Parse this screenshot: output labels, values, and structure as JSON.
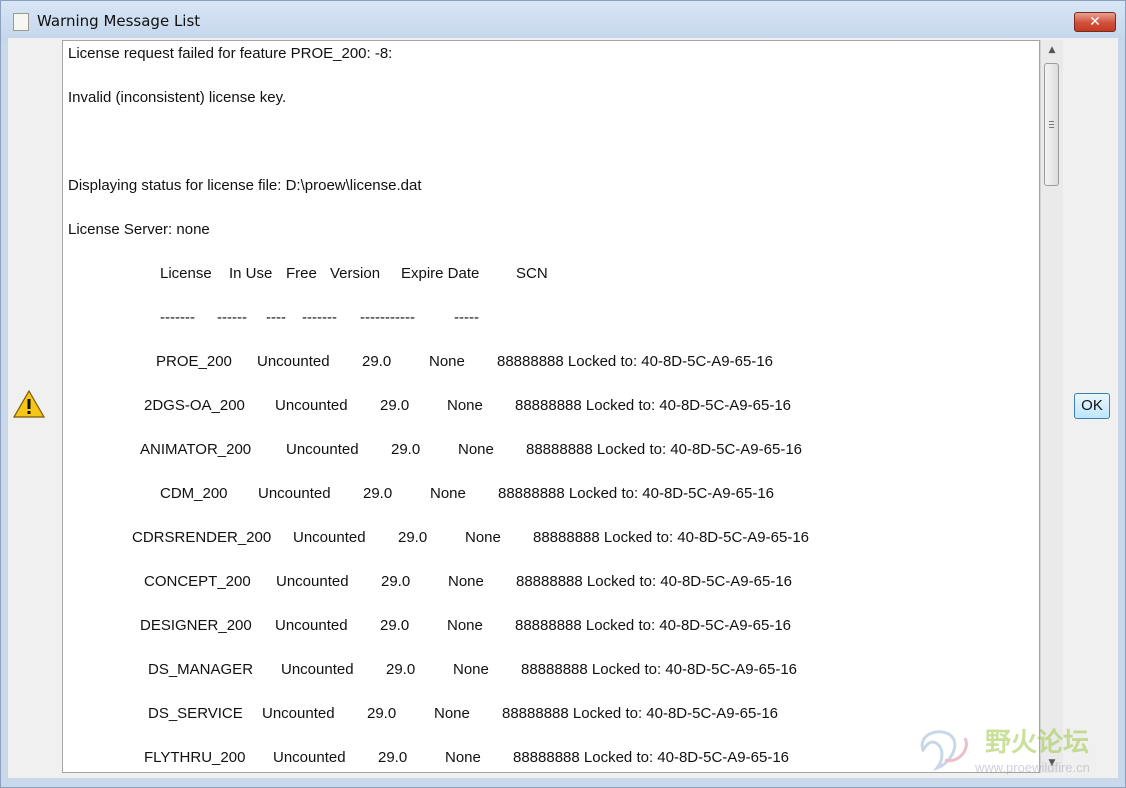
{
  "window": {
    "title": "Warning Message List",
    "close_label": "✕",
    "ok_label": "OK"
  },
  "message": {
    "lines": [
      "License request failed for feature PROE_200: -8:",
      "Invalid (inconsistent) license key.",
      "",
      "Displaying status for license file: D:\\proew\\license.dat",
      "License Server: none"
    ],
    "table_header": [
      "License",
      "In Use",
      "Free",
      "Version",
      "Expire Date",
      "SCN"
    ],
    "table_separator": [
      "-------",
      "------",
      "----",
      "-------",
      "-----------",
      "-----"
    ],
    "rows": [
      {
        "license": "PROE_200",
        "in_use": "Uncounted",
        "version": "29.0",
        "expire": "None",
        "scn": "88888888 Locked to: 40-8D-5C-A9-65-16"
      },
      {
        "license": "2DGS-OA_200",
        "in_use": "Uncounted",
        "version": "29.0",
        "expire": "None",
        "scn": "88888888 Locked to: 40-8D-5C-A9-65-16"
      },
      {
        "license": "ANIMATOR_200",
        "in_use": "Uncounted",
        "version": "29.0",
        "expire": "None",
        "scn": "88888888 Locked to: 40-8D-5C-A9-65-16"
      },
      {
        "license": "CDM_200",
        "in_use": "Uncounted",
        "version": "29.0",
        "expire": "None",
        "scn": "88888888 Locked to: 40-8D-5C-A9-65-16"
      },
      {
        "license": "CDRSRENDER_200",
        "in_use": "Uncounted",
        "version": "29.0",
        "expire": "None",
        "scn": "88888888 Locked to: 40-8D-5C-A9-65-16"
      },
      {
        "license": "CONCEPT_200",
        "in_use": "Uncounted",
        "version": "29.0",
        "expire": "None",
        "scn": "88888888 Locked to: 40-8D-5C-A9-65-16"
      },
      {
        "license": "DESIGNER_200",
        "in_use": "Uncounted",
        "version": "29.0",
        "expire": "None",
        "scn": "88888888 Locked to: 40-8D-5C-A9-65-16"
      },
      {
        "license": "DS_MANAGER",
        "in_use": "Uncounted",
        "version": "29.0",
        "expire": "None",
        "scn": "88888888 Locked to: 40-8D-5C-A9-65-16"
      },
      {
        "license": "DS_SERVICE",
        "in_use": "Uncounted",
        "version": "29.0",
        "expire": "None",
        "scn": "88888888 Locked to: 40-8D-5C-A9-65-16"
      },
      {
        "license": "FLYTHRU_200",
        "in_use": "Uncounted",
        "version": "29.0",
        "expire": "None",
        "scn": "88888888 Locked to: 40-8D-5C-A9-65-16"
      }
    ]
  },
  "icons": {
    "app": "app-window-icon",
    "warning": "warning-triangle-icon",
    "close": "close-icon"
  },
  "watermark": {
    "text": "野火论坛",
    "url": "www.proewildfire.cn"
  }
}
